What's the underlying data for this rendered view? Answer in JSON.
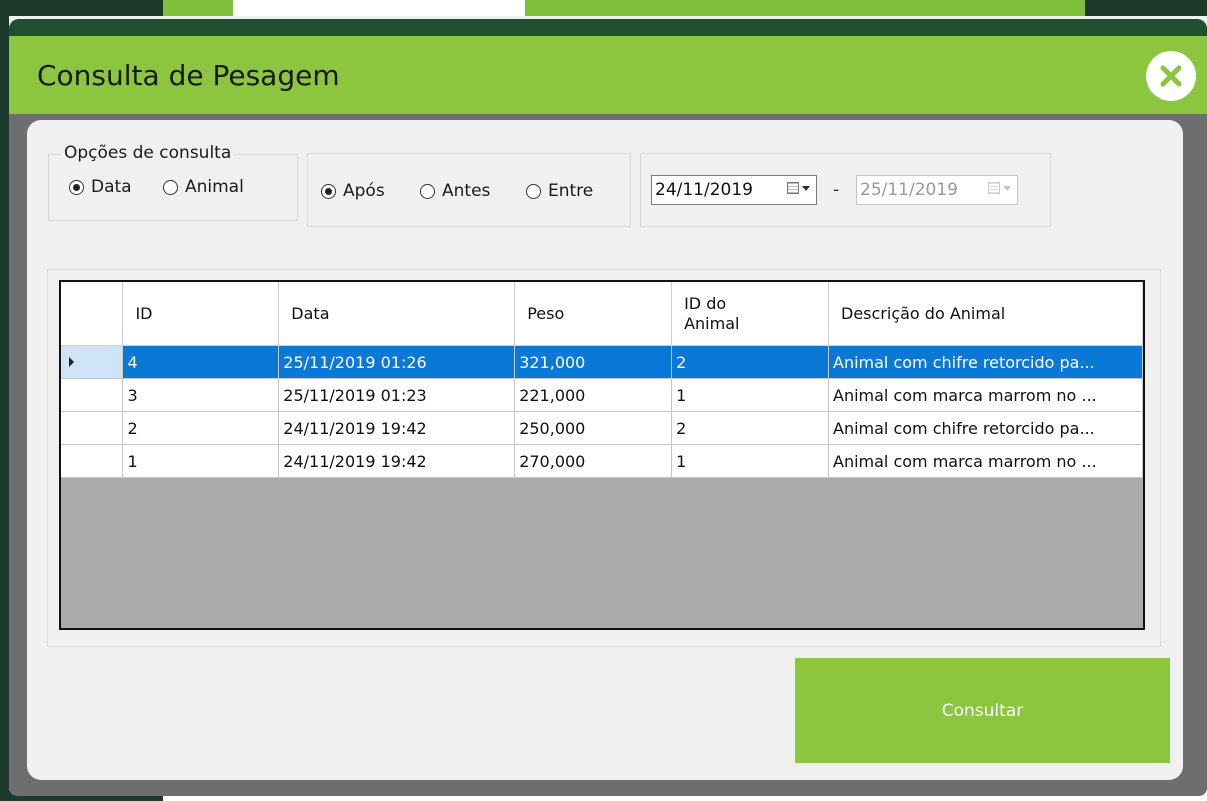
{
  "colors": {
    "accent": "#8cc63e",
    "selection": "#0a78d7",
    "header_band": "#1f5130"
  },
  "dialog": {
    "title": "Consulta de Pesagem",
    "close_icon": "close-x-icon"
  },
  "options": {
    "legend": "Opções  de consulta",
    "type_radios": [
      {
        "label": "Data",
        "checked": true
      },
      {
        "label": "Animal",
        "checked": false
      }
    ],
    "mode_radios": [
      {
        "label": "Após",
        "checked": true
      },
      {
        "label": "Antes",
        "checked": false
      },
      {
        "label": "Entre",
        "checked": false
      }
    ],
    "date_from": "24/11/2019",
    "date_separator": "-",
    "date_to": "25/11/2019"
  },
  "grid": {
    "columns": [
      "ID",
      "Data",
      "Peso",
      "ID do Animal",
      "Descrição do Animal"
    ],
    "rows": [
      {
        "id": "4",
        "data": "25/11/2019 01:26",
        "peso": "321,000",
        "id_animal": "2",
        "descricao": "Animal com chifre retorcido pa...",
        "selected": true
      },
      {
        "id": "3",
        "data": "25/11/2019 01:23",
        "peso": "221,000",
        "id_animal": "1",
        "descricao": "Animal com marca marrom no ...",
        "selected": false
      },
      {
        "id": "2",
        "data": "24/11/2019 19:42",
        "peso": "250,000",
        "id_animal": "2",
        "descricao": "Animal com chifre retorcido pa...",
        "selected": false
      },
      {
        "id": "1",
        "data": "24/11/2019 19:42",
        "peso": "270,000",
        "id_animal": "1",
        "descricao": "Animal com marca marrom no ...",
        "selected": false
      }
    ]
  },
  "actions": {
    "consultar_label": "Consultar"
  }
}
